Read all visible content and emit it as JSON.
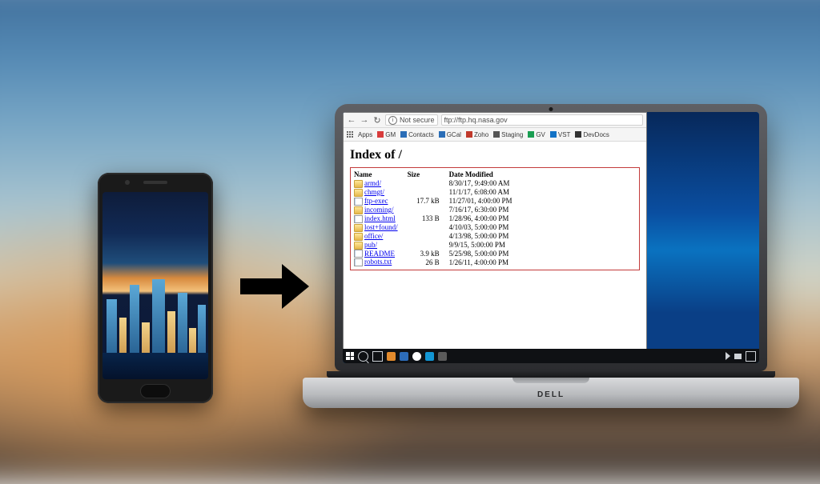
{
  "laptop_brand": "DELL",
  "browser": {
    "nav": {
      "back": "←",
      "fwd": "→",
      "reload": "↻",
      "security_label": "Not secure",
      "url": "ftp://ftp.hq.nasa.gov"
    },
    "bookmarks_label": "Apps",
    "bookmarks": [
      {
        "label": "GM",
        "color": "#d83b3b"
      },
      {
        "label": "Contacts",
        "color": "#2a6db7"
      },
      {
        "label": "GCal",
        "color": "#2a6db7"
      },
      {
        "label": "Zoho",
        "color": "#c0392b"
      },
      {
        "label": "Staging",
        "color": "#555555"
      },
      {
        "label": "GV",
        "color": "#1a9e52"
      },
      {
        "label": "VST",
        "color": "#1373c6"
      },
      {
        "label": "DevDocs",
        "color": "#333333"
      }
    ],
    "page_title": "Index of /",
    "columns": {
      "name": "Name",
      "size": "Size",
      "date": "Date Modified"
    },
    "entries": [
      {
        "name": "armd/",
        "type": "folder",
        "size": "",
        "date": "8/30/17, 9:49:00 AM"
      },
      {
        "name": "chmgt/",
        "type": "folder",
        "size": "",
        "date": "11/1/17, 6:08:00 AM"
      },
      {
        "name": "ftp-exec",
        "type": "file",
        "size": "17.7 kB",
        "date": "11/27/01, 4:00:00 PM"
      },
      {
        "name": "incoming/",
        "type": "folder",
        "size": "",
        "date": "7/16/17, 6:30:00 PM"
      },
      {
        "name": "index.html",
        "type": "file",
        "size": "133 B",
        "date": "1/28/96, 4:00:00 PM"
      },
      {
        "name": "lost+found/",
        "type": "folder",
        "size": "",
        "date": "4/10/03, 5:00:00 PM"
      },
      {
        "name": "office/",
        "type": "folder",
        "size": "",
        "date": "4/13/98, 5:00:00 PM"
      },
      {
        "name": "pub/",
        "type": "folder",
        "size": "",
        "date": "9/9/15, 5:00:00 PM"
      },
      {
        "name": "README",
        "type": "file",
        "size": "3.9 kB",
        "date": "5/25/98, 5:00:00 PM"
      },
      {
        "name": "robots.txt",
        "type": "file",
        "size": "26 B",
        "date": "1/26/11, 4:00:00 PM"
      }
    ]
  }
}
